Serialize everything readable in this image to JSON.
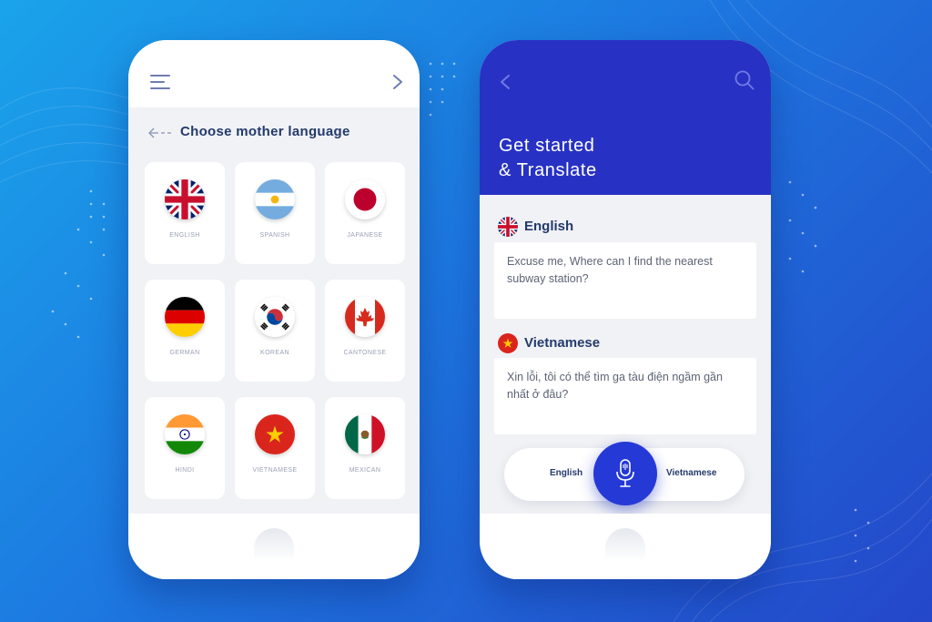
{
  "left_screen": {
    "title": "Choose mother language",
    "languages": [
      {
        "name": "ENGLISH",
        "flag": "uk-flag-icon"
      },
      {
        "name": "SPANISH",
        "flag": "argentina-flag-icon"
      },
      {
        "name": "JAPANESE",
        "flag": "japan-flag-icon"
      },
      {
        "name": "GERMAN",
        "flag": "germany-flag-icon"
      },
      {
        "name": "KOREAN",
        "flag": "south-korea-flag-icon"
      },
      {
        "name": "CANTONESE",
        "flag": "canada-flag-icon"
      },
      {
        "name": "HINDI",
        "flag": "india-flag-icon"
      },
      {
        "name": "VIETNAMESE",
        "flag": "vietnam-flag-icon"
      },
      {
        "name": "MEXICAN",
        "flag": "mexico-flag-icon"
      }
    ]
  },
  "right_screen": {
    "title_line1": "Get started",
    "title_line2": "& Translate",
    "source": {
      "language": "English",
      "text": "Excuse me, Where can I find the nearest subway station?"
    },
    "target": {
      "language": "Vietnamese",
      "text": "Xin lỗi, tôi có thể tìm ga tàu điện ngầm gần nhất ở đâu?"
    },
    "mic_bar": {
      "from": "English",
      "to": "Vietnamese"
    }
  },
  "colors": {
    "background_start": "#1aa3ea",
    "background_end": "#2447c9",
    "header_blue": "#2732c4",
    "mic_blue": "#2539d6",
    "title_navy": "#243a6b",
    "screen_gray": "#f1f2f5"
  }
}
